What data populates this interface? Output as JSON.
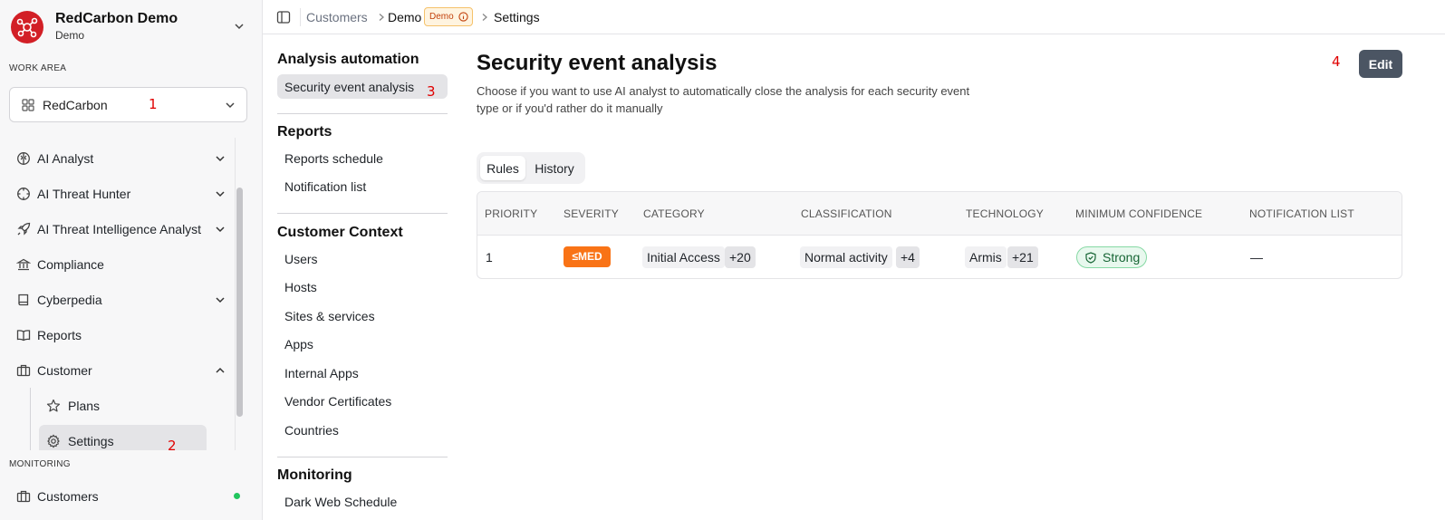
{
  "brand": {
    "title": "RedCarbon Demo",
    "subtitle": "Demo",
    "color": "#d21f26"
  },
  "sidebar": {
    "work_area_label": "WORK AREA",
    "work_area_value": "RedCarbon",
    "items": [
      {
        "label": "AI Analyst",
        "icon": "brain-icon",
        "expandable": true
      },
      {
        "label": "AI Threat Hunter",
        "icon": "crosshair-icon",
        "expandable": true
      },
      {
        "label": "AI Threat Intelligence Analyst",
        "icon": "rocket-icon",
        "expandable": true
      },
      {
        "label": "Compliance",
        "icon": "bank-icon",
        "expandable": false
      },
      {
        "label": "Cyberpedia",
        "icon": "book-icon",
        "expandable": true
      },
      {
        "label": "Reports",
        "icon": "open-book-icon",
        "expandable": false
      },
      {
        "label": "Customer",
        "icon": "briefcase-icon",
        "expandable": true,
        "expanded": true
      }
    ],
    "customer_sub": [
      {
        "label": "Plans",
        "icon": "star-icon"
      },
      {
        "label": "Settings",
        "icon": "gear-icon",
        "active": true
      }
    ],
    "monitoring_label": "MONITORING",
    "monitoring_items": [
      {
        "label": "Customers",
        "icon": "briefcase-icon",
        "status": "online"
      }
    ]
  },
  "annotations": [
    "1",
    "2",
    "3",
    "4"
  ],
  "breadcrumb": {
    "items": [
      "Customers",
      "Demo",
      "Settings"
    ],
    "badge": "Demo"
  },
  "settings_nav": {
    "sections": [
      {
        "title": "Analysis automation",
        "items": [
          "Security event analysis"
        ]
      },
      {
        "title": "Reports",
        "items": [
          "Reports schedule",
          "Notification list"
        ]
      },
      {
        "title": "Customer Context",
        "items": [
          "Users",
          "Hosts",
          "Sites & services",
          "Apps",
          "Internal Apps",
          "Vendor Certificates",
          "Countries"
        ]
      },
      {
        "title": "Monitoring",
        "items": [
          "Dark Web Schedule"
        ]
      }
    ],
    "active": "Security event analysis"
  },
  "main": {
    "title": "Security event analysis",
    "description": "Choose if you want to use AI analyst to automatically close the analysis for each security event type or if you'd rather do it manually",
    "edit_label": "Edit",
    "tabs": [
      {
        "label": "Rules",
        "active": true
      },
      {
        "label": "History",
        "active": false
      }
    ],
    "table": {
      "columns": [
        "PRIORITY",
        "SEVERITY",
        "CATEGORY",
        "CLASSIFICATION",
        "TECHNOLOGY",
        "MINIMUM CONFIDENCE",
        "NOTIFICATION LIST"
      ],
      "rows": [
        {
          "priority": "1",
          "severity": "≤MED",
          "category": "Initial Access",
          "category_more": "+20",
          "classification": "Normal activity",
          "classification_more": "+4",
          "technology": "Armis",
          "technology_more": "+21",
          "confidence": "Strong",
          "notification": "—"
        }
      ]
    }
  },
  "colors": {
    "severity_med": "#f97316",
    "confidence_strong": "#166534",
    "edit_button": "#4b5563",
    "online": "#22c55e"
  }
}
